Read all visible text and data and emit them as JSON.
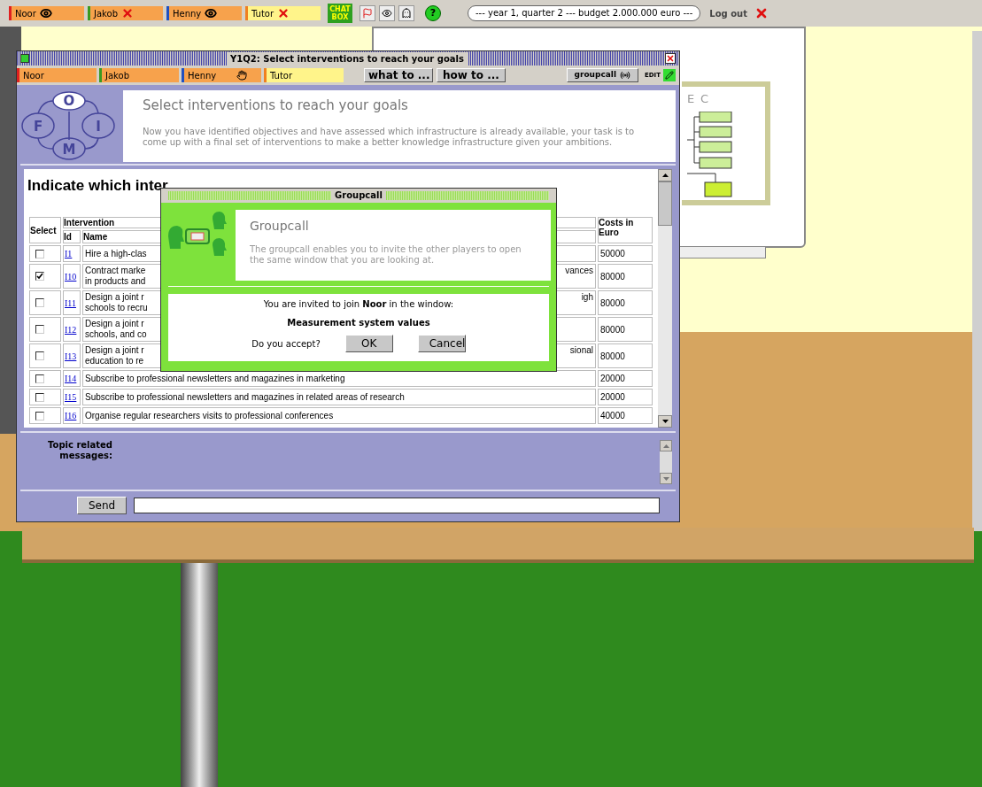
{
  "top_bar": {
    "players": [
      {
        "name": "Noor",
        "color": "#e02020",
        "selected": false,
        "kind": "eye"
      },
      {
        "name": "Jakob",
        "color": "#3a9a20",
        "selected": false,
        "kind": "cross"
      },
      {
        "name": "Henny",
        "color": "#2050c0",
        "selected": false,
        "kind": "eye"
      },
      {
        "name": "Tutor",
        "color": "#f08020",
        "selected": true,
        "kind": "cross"
      }
    ],
    "chat_label": "CHAT BOX",
    "help_label": "?",
    "budget": "--- year 1, quarter 2 --- budget 2.000.000 euro ---",
    "logout": "Log out"
  },
  "whiteboard": {
    "label": "E C"
  },
  "window": {
    "title": "Y1Q2: Select interventions to reach your goals",
    "players": [
      {
        "name": "Noor",
        "color": "#e02020",
        "selected": false,
        "hand": false
      },
      {
        "name": "Jakob",
        "color": "#3a9a20",
        "selected": false,
        "hand": false
      },
      {
        "name": "Henny",
        "color": "#2050c0",
        "selected": false,
        "hand": true
      },
      {
        "name": "Tutor",
        "color": "#f08020",
        "selected": true,
        "hand": false
      }
    ],
    "buttons": [
      "what to ...",
      "how to ..."
    ],
    "groupcall": "groupcall",
    "edit": "EDIT",
    "logo_letters": [
      "O",
      "F",
      "I",
      "M"
    ],
    "heading": "Select interventions to reach your goals",
    "description": "Now you have identified objectives and have assessed which infrastructure is already available, your task is to come up with a final set of interventions to make a better knowledge infrastructure given your ambitions.",
    "table_title": "Indicate which inter",
    "columns": {
      "select": "Select",
      "intervention": "Intervention",
      "id": "Id",
      "name": "Name",
      "costs": "Costs in Euro"
    },
    "rows": [
      {
        "checked": false,
        "id": "I1",
        "name": "Hire a high-clas",
        "name_end": "",
        "cost": "50000"
      },
      {
        "checked": true,
        "id": "I10",
        "name": "Contract marke\nin products and",
        "name_end": "vances",
        "cost": "80000"
      },
      {
        "checked": false,
        "id": "I11",
        "name": "Design a joint r\nschools to recru",
        "name_end": "igh",
        "cost": "80000"
      },
      {
        "checked": false,
        "id": "I12",
        "name": "Design a joint r\nschools, and co",
        "name_end": "",
        "cost": "80000"
      },
      {
        "checked": false,
        "id": "I13",
        "name": "Design a joint r\neducation to re",
        "name_end": "sional",
        "cost": "80000"
      },
      {
        "checked": false,
        "id": "I14",
        "name": "Subscribe to professional newsletters and magazines in marketing",
        "name_end": "",
        "cost": "20000"
      },
      {
        "checked": false,
        "id": "I15",
        "name": "Subscribe to professional newsletters and magazines in related areas of research",
        "name_end": "",
        "cost": "20000"
      },
      {
        "checked": false,
        "id": "I16",
        "name": "Organise regular researchers visits to professional conferences",
        "name_end": "",
        "cost": "40000"
      }
    ],
    "messages_label": "Topic related messages:",
    "send": "Send"
  },
  "dialog": {
    "title": "Groupcall",
    "heading": "Groupcall",
    "description": "The groupcall enables you to invite the other players to open the same window that you are looking at.",
    "invitation": "You are invited to join **Noor** in the window:",
    "window_name": "Measurement system values",
    "question": "Do you accept?",
    "ok": "OK",
    "cancel": "Cancel"
  }
}
